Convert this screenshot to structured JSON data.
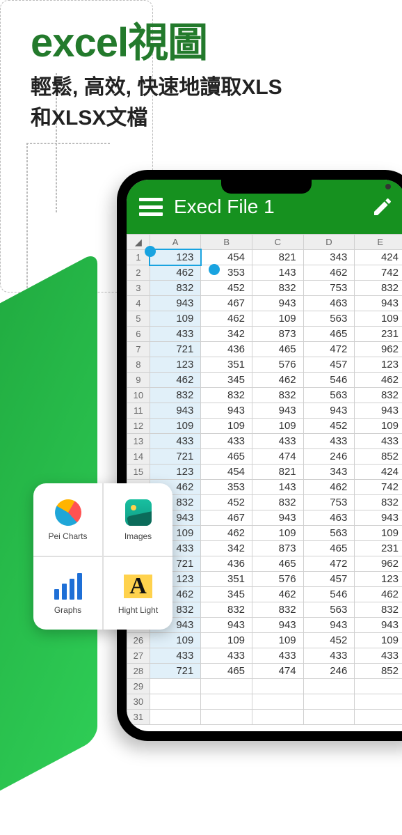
{
  "heading": {
    "title_latin": "excel",
    "title_cjk": "視圖",
    "subtitle_line1": "輕鬆, 高效, 快速地讀取XLS",
    "subtitle_line2": "和XLSX文檔"
  },
  "appbar": {
    "title": "Execl File 1"
  },
  "sheet": {
    "columns": [
      "A",
      "B",
      "C",
      "D",
      "E"
    ],
    "active_cell_value": "123",
    "rows": [
      [
        123,
        454,
        821,
        343,
        424
      ],
      [
        462,
        353,
        143,
        462,
        742
      ],
      [
        832,
        452,
        832,
        753,
        832
      ],
      [
        943,
        467,
        943,
        463,
        943
      ],
      [
        109,
        462,
        109,
        563,
        109
      ],
      [
        433,
        342,
        873,
        465,
        231
      ],
      [
        721,
        436,
        465,
        472,
        962
      ],
      [
        123,
        351,
        576,
        457,
        123
      ],
      [
        462,
        345,
        462,
        546,
        462
      ],
      [
        832,
        832,
        832,
        563,
        832
      ],
      [
        943,
        943,
        943,
        943,
        943
      ],
      [
        109,
        109,
        109,
        452,
        109
      ],
      [
        433,
        433,
        433,
        433,
        433
      ],
      [
        721,
        465,
        474,
        246,
        852
      ],
      [
        123,
        454,
        821,
        343,
        424
      ],
      [
        462,
        353,
        143,
        462,
        742
      ],
      [
        832,
        452,
        832,
        753,
        832
      ],
      [
        943,
        467,
        943,
        463,
        943
      ],
      [
        109,
        462,
        109,
        563,
        109
      ],
      [
        433,
        342,
        873,
        465,
        231
      ],
      [
        721,
        436,
        465,
        472,
        962
      ],
      [
        123,
        351,
        576,
        457,
        123
      ],
      [
        462,
        345,
        462,
        546,
        462
      ],
      [
        832,
        832,
        832,
        563,
        832
      ],
      [
        943,
        943,
        943,
        943,
        943
      ],
      [
        109,
        109,
        109,
        452,
        109
      ],
      [
        433,
        433,
        433,
        433,
        433
      ],
      [
        721,
        465,
        474,
        246,
        852
      ]
    ],
    "empty_rows": [
      29,
      30,
      31
    ]
  },
  "tools": [
    {
      "label": "Pei Charts",
      "icon": "pie-chart-icon"
    },
    {
      "label": "Images",
      "icon": "image-icon"
    },
    {
      "label": "Graphs",
      "icon": "graph-icon"
    },
    {
      "label": "Hight Light",
      "icon": "highlight-icon"
    }
  ]
}
